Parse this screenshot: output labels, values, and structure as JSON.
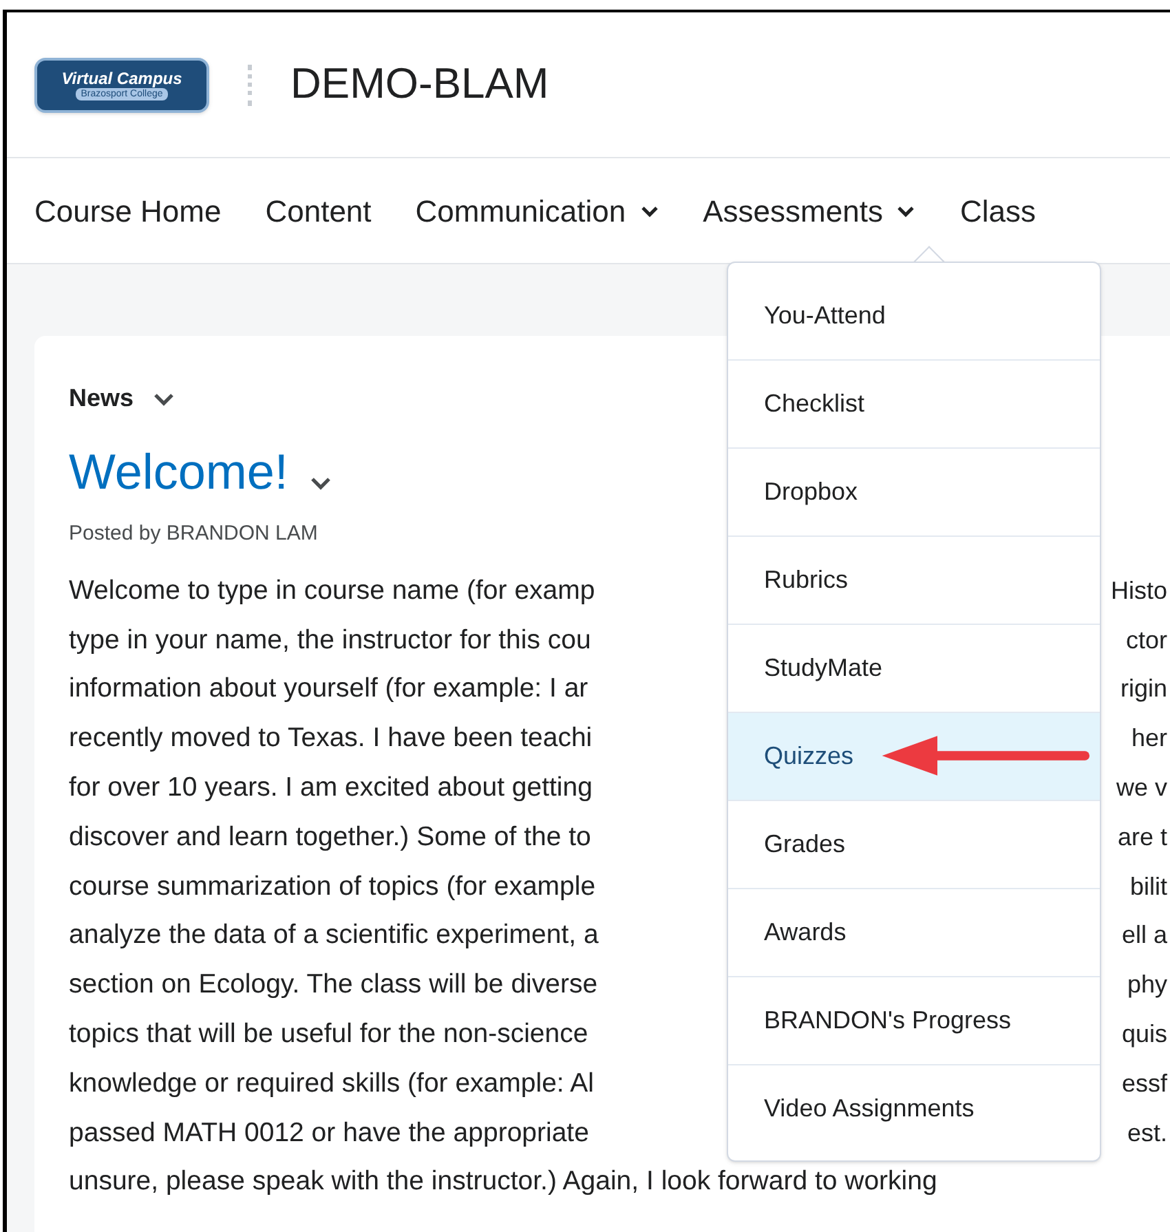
{
  "header": {
    "logo": {
      "title": "Virtual Campus",
      "subtitle": "Brazosport College"
    },
    "course_title": "DEMO-BLAM"
  },
  "nav": [
    {
      "label": "Course Home",
      "dropdown": false
    },
    {
      "label": "Content",
      "dropdown": false
    },
    {
      "label": "Communication",
      "dropdown": true
    },
    {
      "label": "Assessments",
      "dropdown": true
    },
    {
      "label": "Class",
      "dropdown": false
    }
  ],
  "news": {
    "heading": "News",
    "title": "Welcome!",
    "posted_by": "Posted by BRANDON LAM",
    "lines": [
      {
        "left": "Welcome to type in course name (for examp",
        "right": "Histo"
      },
      {
        "left": "type in your name, the instructor for this cou",
        "right": "ctor"
      },
      {
        "left": "information about yourself (for example: I ar",
        "right": "rigin"
      },
      {
        "left": "recently moved to Texas. I have been teachi",
        "right": "her"
      },
      {
        "left": "for over 10 years. I am excited about getting",
        "right": "we v"
      },
      {
        "left": "discover and learn together.) Some of the to",
        "right": "are t"
      },
      {
        "left": "course summarization of topics (for example",
        "right": "bilit"
      },
      {
        "left": "analyze the data of a scientific experiment, a",
        "right": "ell a"
      },
      {
        "left": "section on Ecology. The class will be diverse",
        "right": "phy"
      },
      {
        "left": "topics that will be useful for the non-science",
        "right": "quis"
      },
      {
        "left": "knowledge or required skills (for example: Al",
        "right": "essf"
      },
      {
        "left": "passed MATH 0012 or have the appropriate",
        "right": "est."
      },
      {
        "left": "unsure, please speak with the instructor.) Again, I look forward to working"
      }
    ]
  },
  "menu": {
    "items": [
      {
        "label": "You-Attend",
        "selected": false
      },
      {
        "label": "Checklist",
        "selected": false
      },
      {
        "label": "Dropbox",
        "selected": false
      },
      {
        "label": "Rubrics",
        "selected": false
      },
      {
        "label": "StudyMate",
        "selected": false
      },
      {
        "label": "Quizzes",
        "selected": true
      },
      {
        "label": "Grades",
        "selected": false
      },
      {
        "label": "Awards",
        "selected": false
      },
      {
        "label": "BRANDON's Progress",
        "selected": false
      },
      {
        "label": "Video Assignments",
        "selected": false
      }
    ]
  },
  "annotation": {
    "kind": "arrow"
  }
}
